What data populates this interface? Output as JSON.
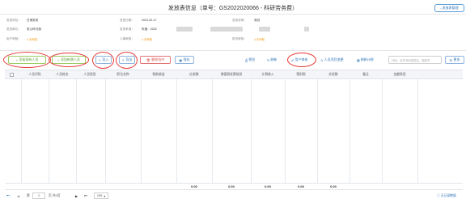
{
  "header": {
    "title": "发放表信息（单号：GS2022020066 - 科研劳务费）",
    "back_label": "发放表管理"
  },
  "info": {
    "issue_item_label": "发放项目：",
    "issue_item_value": "日常劳务",
    "issue_date_label": "发放日期：",
    "issue_date_value": "2022-02-17",
    "issue_note_label": "发放说明：",
    "issue_note_value": "测试",
    "issue_unit_label": "发放单位：",
    "issue_unit_value": "张公岭仓部",
    "issue_source_label": "发放来源：",
    "issue_source_value": "年度：2022",
    "user_audit_label": "用户审核：",
    "user_audit_value": "● 未审核",
    "hr_audit_label": "人事审核：",
    "hr_audit_value": "● 未审核",
    "finance_audit_label": "财务审核：",
    "finance_audit_value": "● 未审核"
  },
  "toolbar": {
    "add_existing": "添加现有人员",
    "add_new": "添加新增人员",
    "import": "导入",
    "export": "导出",
    "delete_selected": "删除选中",
    "save": "保存",
    "preview": "预览",
    "refresh": "刷新",
    "user_review": "用户审核",
    "person_change": "人员项目变更",
    "tax_refresh": "刷新计税",
    "search_placeholder": "代码、证件号码或姓名，按回车",
    "more": "更多"
  },
  "table": {
    "columns": [
      "人员代码",
      "人员姓名",
      "人员类型",
      "职位名称",
      "税前收益",
      "应发数",
      "增值税发票抵扣",
      "计税收入",
      "预扣税",
      "实发数",
      "备注",
      "金额类型"
    ],
    "totals": [
      "0.00",
      "0.00",
      "0.00",
      "0.00",
      "0.00"
    ]
  },
  "pagination": {
    "page_prefix": "第",
    "page_value": "1",
    "page_suffix": "页 共0页",
    "page_size": "100",
    "empty_text": "无记录数据"
  },
  "colors": {
    "accent": "#2e75b6",
    "warning": "#f0a020",
    "danger": "#e53935",
    "success": "#5a9b2e"
  }
}
